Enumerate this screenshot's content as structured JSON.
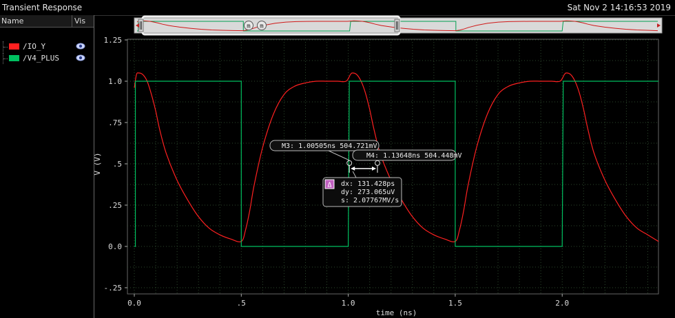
{
  "window": {
    "title": "Transient Response",
    "datetime": "Sat Nov 2 14:16:53 2019"
  },
  "legend": {
    "col_name": "Name",
    "col_vis": "Vis",
    "items": [
      {
        "label": "/IO_Y",
        "color": "#ff2020",
        "icon": "eye-icon"
      },
      {
        "label": "/V4_PLUS",
        "color": "#00c060",
        "icon": "eye-icon"
      }
    ]
  },
  "overview": {
    "handle_left": "⏸",
    "handle_right": "⏸",
    "marker_buttons": [
      "m",
      "m"
    ]
  },
  "chart_data": {
    "type": "line",
    "xlabel": "time (ns)",
    "ylabel": "V (V)",
    "xlim": [
      0.0,
      2.45
    ],
    "ylim": [
      -0.25,
      1.25
    ],
    "xticks": [
      "0.0",
      ".5",
      "1.0",
      "1.5",
      "2.0"
    ],
    "xtick_values": [
      0.0,
      0.5,
      1.0,
      1.5,
      2.0
    ],
    "yticks": [
      "1.25",
      "1.0",
      ".75",
      ".5",
      ".25",
      "0.0",
      "-.25"
    ],
    "ytick_values": [
      1.25,
      1.0,
      0.75,
      0.5,
      0.25,
      0.0,
      -0.25
    ],
    "grid": true,
    "series": [
      {
        "name": "/IO_Y",
        "color": "#ff2020",
        "x": [
          0.0,
          0.01,
          0.02,
          0.04,
          0.06,
          0.08,
          0.1,
          0.12,
          0.15,
          0.2,
          0.25,
          0.3,
          0.35,
          0.4,
          0.45,
          0.5,
          0.52,
          0.54,
          0.56,
          0.6,
          0.65,
          0.7,
          0.75,
          0.8,
          0.85,
          0.9,
          0.95,
          0.99,
          1.01,
          1.02,
          1.04,
          1.06,
          1.08,
          1.1,
          1.12,
          1.15,
          1.2,
          1.25,
          1.3,
          1.35,
          1.4,
          1.45,
          1.5,
          1.52,
          1.54,
          1.56,
          1.6,
          1.65,
          1.7,
          1.75,
          1.8,
          1.85,
          1.9,
          1.95,
          1.99,
          2.01,
          2.02,
          2.04,
          2.06,
          2.08,
          2.1,
          2.12,
          2.15,
          2.2,
          2.25,
          2.3,
          2.35,
          2.4,
          2.45
        ],
        "values": [
          0.96,
          1.04,
          1.05,
          1.04,
          1.0,
          0.92,
          0.82,
          0.7,
          0.56,
          0.4,
          0.28,
          0.18,
          0.11,
          0.07,
          0.045,
          0.03,
          0.1,
          0.22,
          0.37,
          0.6,
          0.8,
          0.92,
          0.97,
          0.99,
          1.0,
          1.0,
          1.0,
          1.0,
          1.04,
          1.05,
          1.04,
          1.0,
          0.93,
          0.83,
          0.71,
          0.56,
          0.4,
          0.28,
          0.18,
          0.11,
          0.07,
          0.045,
          0.03,
          0.1,
          0.22,
          0.37,
          0.6,
          0.8,
          0.92,
          0.97,
          0.99,
          1.0,
          1.0,
          1.0,
          1.0,
          1.04,
          1.05,
          1.04,
          1.0,
          0.93,
          0.83,
          0.71,
          0.56,
          0.4,
          0.28,
          0.18,
          0.11,
          0.07,
          0.03
        ]
      },
      {
        "name": "/V4_PLUS",
        "color": "#00c060",
        "x": [
          0.0,
          0.005,
          0.005,
          0.5,
          0.5,
          0.505,
          0.505,
          1.0,
          1.0,
          1.005,
          1.005,
          1.5,
          1.5,
          1.505,
          1.505,
          2.0,
          2.0,
          2.005,
          2.005,
          2.45
        ],
        "values": [
          0.0,
          0.0,
          1.0,
          1.0,
          0.0,
          0.0,
          0.0,
          0.0,
          0.0,
          1.0,
          1.0,
          1.0,
          0.0,
          0.0,
          0.0,
          0.0,
          0.0,
          1.0,
          1.0,
          1.0
        ]
      }
    ],
    "markers": [
      {
        "id": "M3",
        "label": "M3: 1.00505ns 504.721mV",
        "x": 1.00505,
        "y": 0.504721
      },
      {
        "id": "M4",
        "label": "M4: 1.13648ns 504.448mV",
        "x": 1.13648,
        "y": 0.504448
      }
    ],
    "delta": {
      "symbol": "Δ",
      "lines": [
        "dx: 131.428ps",
        "dy: 273.065uV",
        " s: 2.07767MV/s"
      ]
    }
  }
}
